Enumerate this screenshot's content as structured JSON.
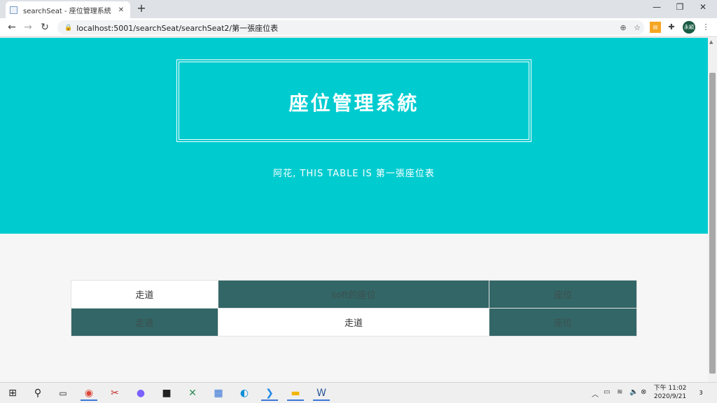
{
  "browser": {
    "tab_title": "searchSeat - 座位管理系統",
    "tab_close": "✕",
    "new_tab": "+",
    "minimize": "—",
    "restore": "❐",
    "close": "✕",
    "url": "localhost:5001/searchSeat/searchSeat2/第一張座位表",
    "profile_label": "永穎"
  },
  "page": {
    "title": "座位管理系統",
    "subtitle": "阿花, THIS TABLE IS 第一張座位表"
  },
  "seat_rows": [
    [
      {
        "label": "走道",
        "type": "aisle"
      },
      {
        "label": "soft的座位",
        "type": "seat"
      },
      {
        "label": "座位",
        "type": "seat"
      }
    ],
    [
      {
        "label": "走道",
        "type": "seat"
      },
      {
        "label": "走道",
        "type": "aisle"
      },
      {
        "label": "座位",
        "type": "seat"
      }
    ]
  ],
  "taskbar": {
    "clock_line1": "下午 11:02",
    "clock_line2": "2020/9/21",
    "notification_count": "3"
  },
  "colors": {
    "hero": "#00ccd0",
    "seat": "#336666",
    "aisle": "#ffffff"
  }
}
